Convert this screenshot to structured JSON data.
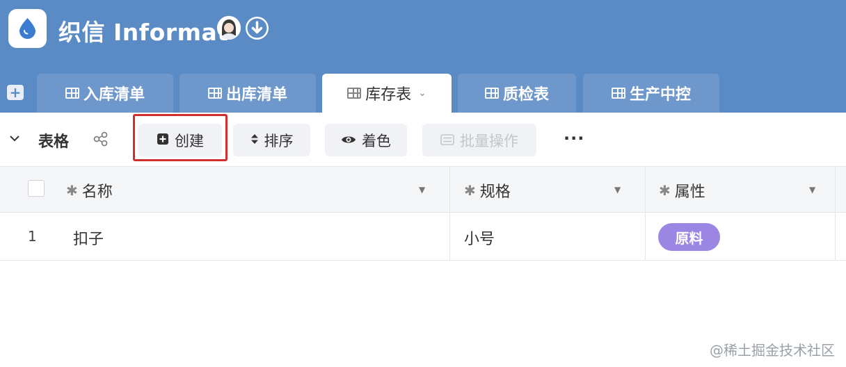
{
  "app": {
    "title": "织信 Informat"
  },
  "tabs": [
    {
      "label": "入库清单"
    },
    {
      "label": "出库清单"
    },
    {
      "label": "库存表"
    },
    {
      "label": "质检表"
    },
    {
      "label": "生产中控"
    }
  ],
  "toolbar": {
    "view_label": "表格",
    "create_label": "创建",
    "sort_label": "排序",
    "color_label": "着色",
    "batch_label": "批量操作",
    "more_label": "···"
  },
  "table": {
    "columns": [
      "名称",
      "规格",
      "属性"
    ],
    "rows": [
      {
        "index": "1",
        "name": "扣子",
        "spec": "小号",
        "attr": "原料"
      }
    ]
  },
  "colors": {
    "header_bg": "#5b8bc4",
    "tab_bg": "#6e98cc",
    "highlight": "#d0302d",
    "tag_bg": "#9b87e3"
  },
  "icons": [
    "app-logo-icon",
    "avatar-icon",
    "download-icon",
    "add-icon",
    "table-grid-icon",
    "chevron-down-icon",
    "share-icon",
    "plus-square-icon",
    "sort-icon",
    "eye-icon",
    "list-icon",
    "more-icon"
  ],
  "watermark": "@稀土掘金技术社区"
}
